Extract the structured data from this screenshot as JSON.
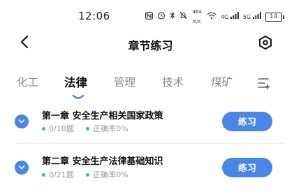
{
  "status_bar": {
    "time": "12:06",
    "net_speed_value": "464",
    "net_speed_unit": "K/s",
    "signal_1": "4G",
    "signal_2": "5G",
    "battery": "14"
  },
  "header": {
    "title": "章节练习"
  },
  "tabs": [
    {
      "label": "化工",
      "active": false
    },
    {
      "label": "法律",
      "active": true
    },
    {
      "label": "管理",
      "active": false
    },
    {
      "label": "技术",
      "active": false
    },
    {
      "label": "煤矿",
      "active": false
    }
  ],
  "chapters": [
    {
      "title": "第一章 安全生产相关国家政策",
      "progress": "0/10题",
      "accuracy": "正确率0%",
      "button": "练习"
    },
    {
      "title": "第二章 安全生产法律基础知识",
      "progress": "0/21题",
      "accuracy": "正确率0%",
      "button": "练习"
    }
  ],
  "colors": {
    "accent": "#4a86e8",
    "progress_dot": "#4cbf6e"
  }
}
